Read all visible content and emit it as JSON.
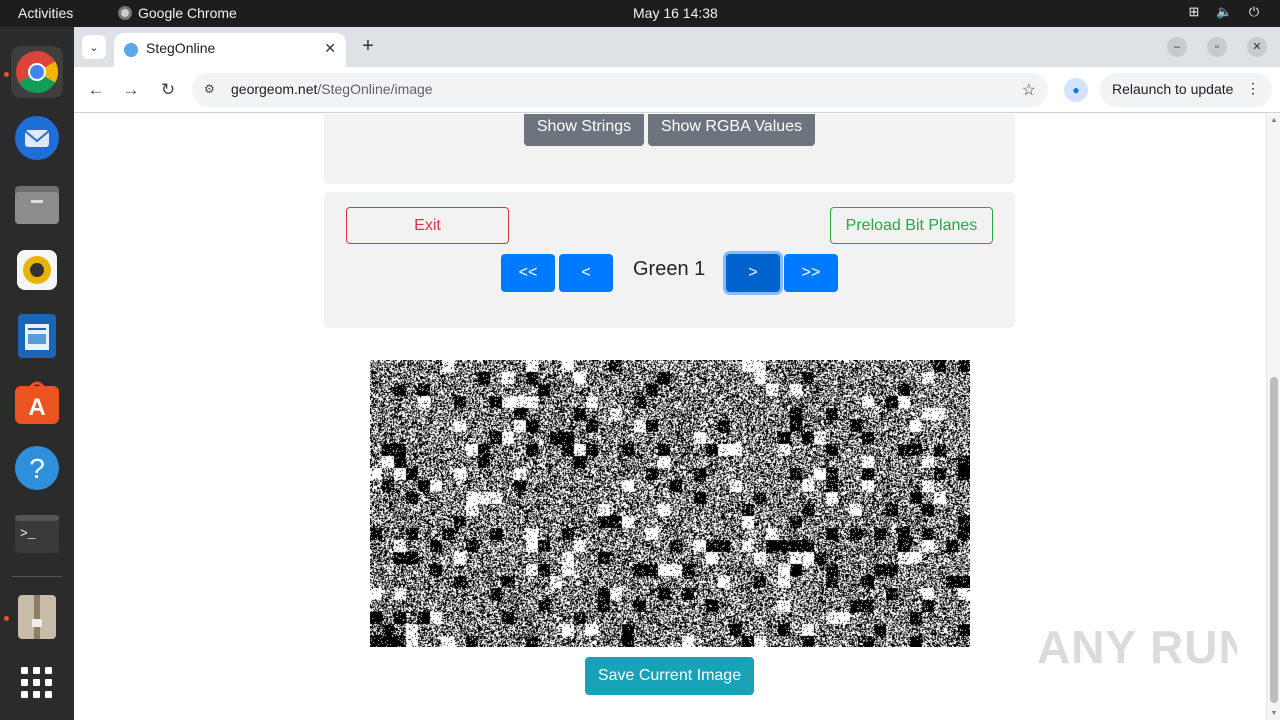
{
  "system_bar": {
    "activities": "Activities",
    "app_name": "Google Chrome",
    "clock": "May 16  14:38",
    "tray_icons": [
      "network-icon",
      "volume-icon",
      "power-icon"
    ]
  },
  "dock": {
    "apps": [
      "chrome-icon",
      "thunderbird-icon",
      "files-icon",
      "rhythmbox-icon",
      "writer-icon",
      "app-center-icon",
      "help-icon",
      "terminal-icon",
      "archive-manager-icon",
      "app-grid-icon"
    ]
  },
  "browser": {
    "tab_title": "StegOnline",
    "url_host": "georgeom.net",
    "url_path": "/StegOnline/image",
    "relaunch_label": "Relaunch to update"
  },
  "page": {
    "top_buttons": {
      "show_strings": "Show Strings",
      "show_rgba": "Show RGBA Values"
    },
    "exit_label": "Exit",
    "preload_label": "Preload Bit Planes",
    "nav": {
      "first": "<<",
      "prev": "<",
      "current_plane": "Green 1",
      "next": ">",
      "last": ">>"
    },
    "save_label": "Save Current Image"
  },
  "watermark": "ANY RUN",
  "colors": {
    "primary": "#007bff",
    "secondary": "#6c757d",
    "danger": "#dc3545",
    "success": "#28a745",
    "info": "#17a2b8"
  }
}
